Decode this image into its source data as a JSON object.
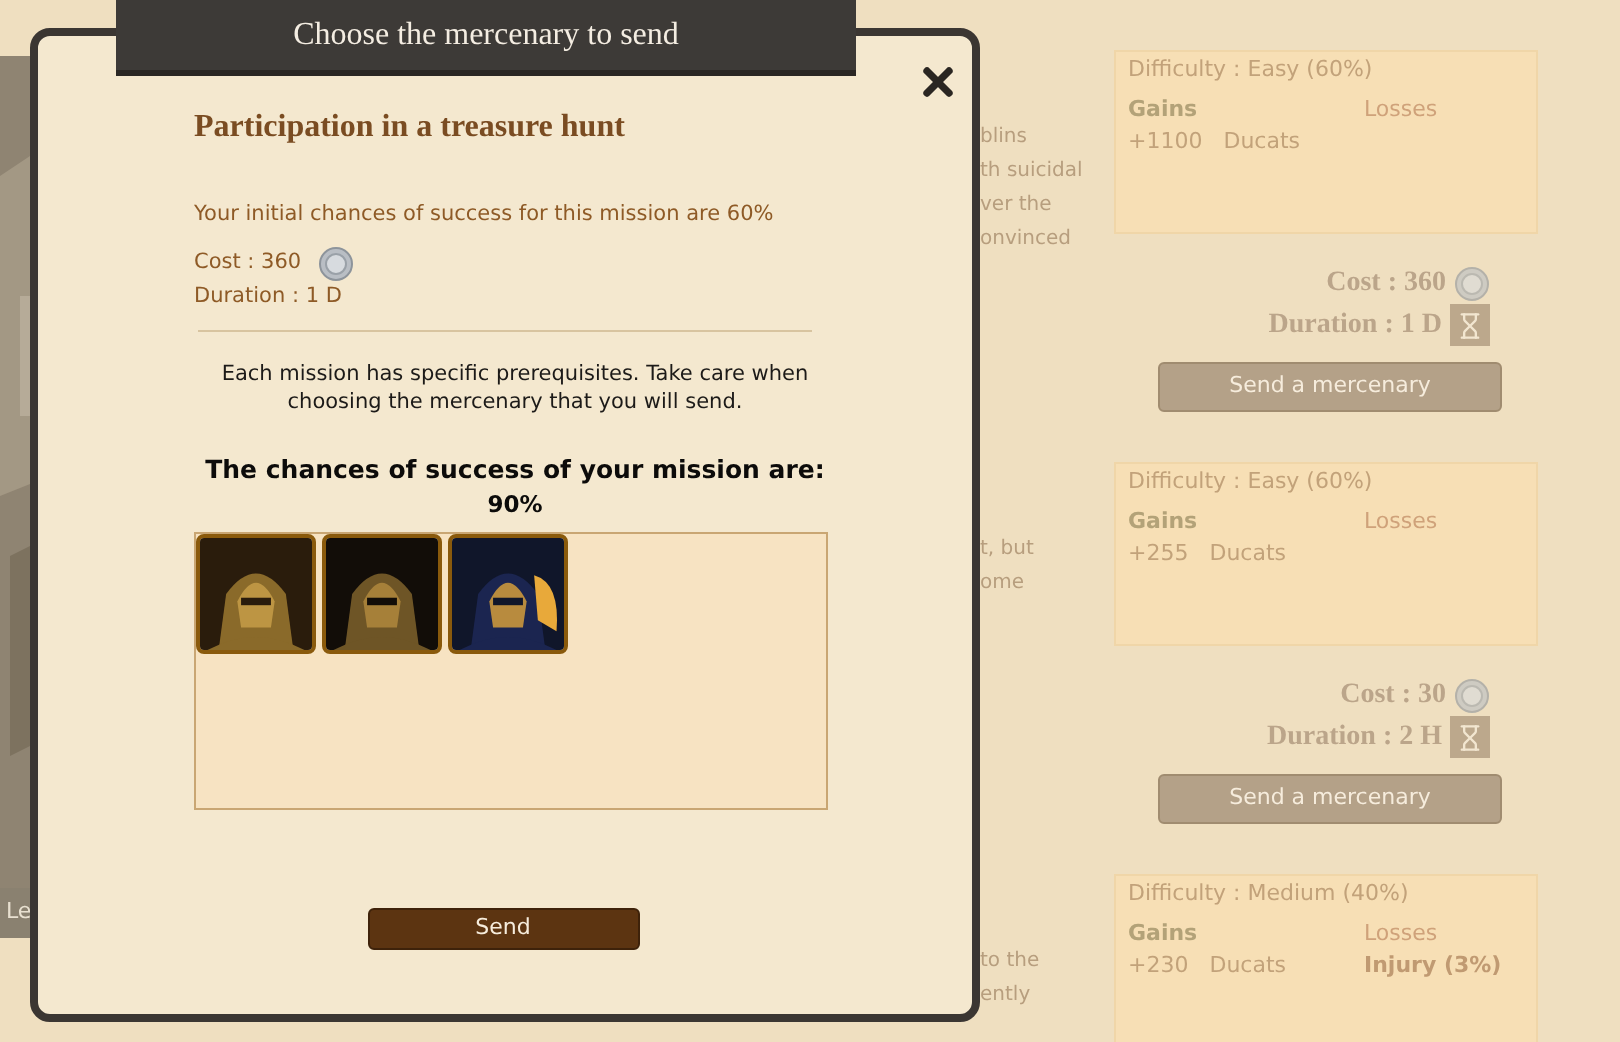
{
  "background_page": {
    "side_label": "Le",
    "missions": [
      {
        "text_fragments": [
          "blins",
          "th suicidal",
          "ver the",
          "onvinced"
        ],
        "difficulty": "Difficulty : Easy (60%)",
        "gains_label": "Gains",
        "losses_label": "Losses",
        "gains": [
          "+1100",
          "Ducats"
        ],
        "cost": "Cost : 360",
        "duration": "Duration : 1 D",
        "button": "Send a mercenary"
      },
      {
        "text_fragments": [
          "t, but",
          "ome"
        ],
        "difficulty": "Difficulty : Easy (60%)",
        "gains_label": "Gains",
        "losses_label": "Losses",
        "gains": [
          "+255",
          "Ducats"
        ],
        "cost": "Cost : 30",
        "duration": "Duration : 2 H",
        "button": "Send a mercenary"
      },
      {
        "text_fragments": [
          "to the",
          "ently"
        ],
        "difficulty": "Difficulty : Medium (40%)",
        "gains_label": "Gains",
        "losses_label": "Losses",
        "gains": [
          "+230",
          "Ducats"
        ],
        "losses": [
          "Injury (3%)"
        ]
      }
    ]
  },
  "dialog": {
    "title": "Choose the mercenary to send",
    "mission_title": "Participation in a treasure hunt",
    "initial_chances": "Your initial chances of success for this mission are 60%",
    "cost": "Cost : 360",
    "duration": "Duration : 1 D",
    "prerequisites": "Each mission has specific prerequisites. Take care when choosing the mercenary that you will send.",
    "chances_heading": "The chances of success of your mission are:",
    "chances_value": "90%",
    "send_button": "Send"
  }
}
